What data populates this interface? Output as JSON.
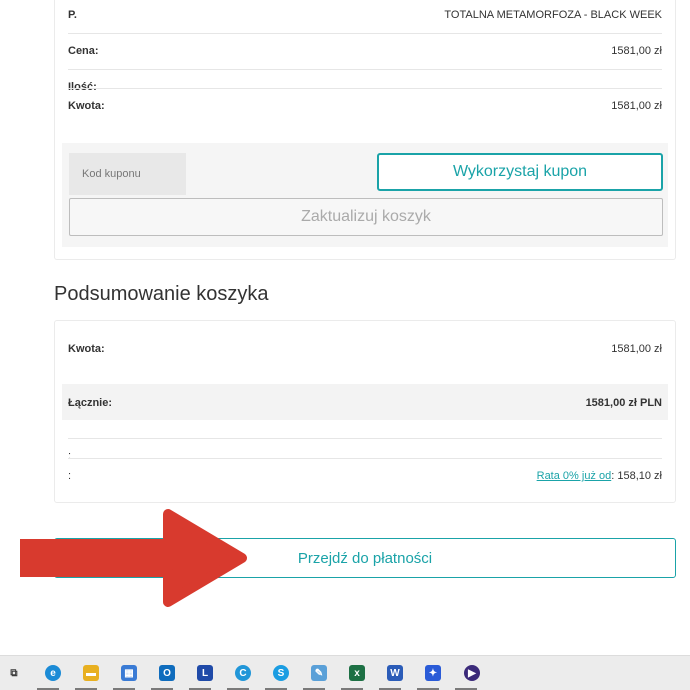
{
  "cart": {
    "product_label": "P.",
    "product_value": "TOTALNA METAMORFOZA - BLACK WEEK",
    "price_label": "Cena:",
    "price_value": "1581,00 zł",
    "quantity_label": "Ilość:",
    "amount_label": "Kwota:",
    "amount_value": "1581,00 zł"
  },
  "coupon": {
    "placeholder": "Kod kuponu",
    "apply_label": "Wykorzystaj kupon",
    "update_label": "Zaktualizuj koszyk"
  },
  "summary": {
    "title": "Podsumowanie koszyka",
    "amount_label": "Kwota:",
    "amount_value": "1581,00 zł",
    "total_label": "Łącznie:",
    "total_value": "1581,00 zł PLN",
    "empty_label": ":",
    "installment_label": ":",
    "installment_link": "Rata 0% już od",
    "installment_value": ": 158,10 zł"
  },
  "checkout": {
    "label": "Przejdź do płatności"
  },
  "taskbar": {
    "icons": [
      {
        "name": "task-view-icon",
        "glyph": "⧉",
        "color": "#3a3a3a"
      },
      {
        "name": "edge-icon",
        "glyph": "e",
        "color": "#1b8bd6"
      },
      {
        "name": "file-explorer-icon",
        "glyph": "▬",
        "color": "#e8b021"
      },
      {
        "name": "microsoft-store-icon",
        "glyph": "▦",
        "color": "#3a7bd5"
      },
      {
        "name": "outlook-icon",
        "glyph": "O",
        "color": "#0f6cbd"
      },
      {
        "name": "l-app-icon",
        "glyph": "L",
        "color": "#1f4aa8"
      },
      {
        "name": "copilot-icon",
        "glyph": "C",
        "color": "#2196d8"
      },
      {
        "name": "skype-icon",
        "glyph": "S",
        "color": "#1b9de2"
      },
      {
        "name": "paint-icon",
        "glyph": "✎",
        "color": "#5aa0d8"
      },
      {
        "name": "excel-icon",
        "glyph": "x",
        "color": "#1d7044"
      },
      {
        "name": "word-icon",
        "glyph": "W",
        "color": "#2b5cb8"
      },
      {
        "name": "app-blue-icon",
        "glyph": "✦",
        "color": "#2a5bd7"
      },
      {
        "name": "media-player-icon",
        "glyph": "▶",
        "color": "#3b2a7a"
      }
    ]
  },
  "colors": {
    "accent": "#1aa3a8",
    "arrow": "#d83a2e"
  }
}
